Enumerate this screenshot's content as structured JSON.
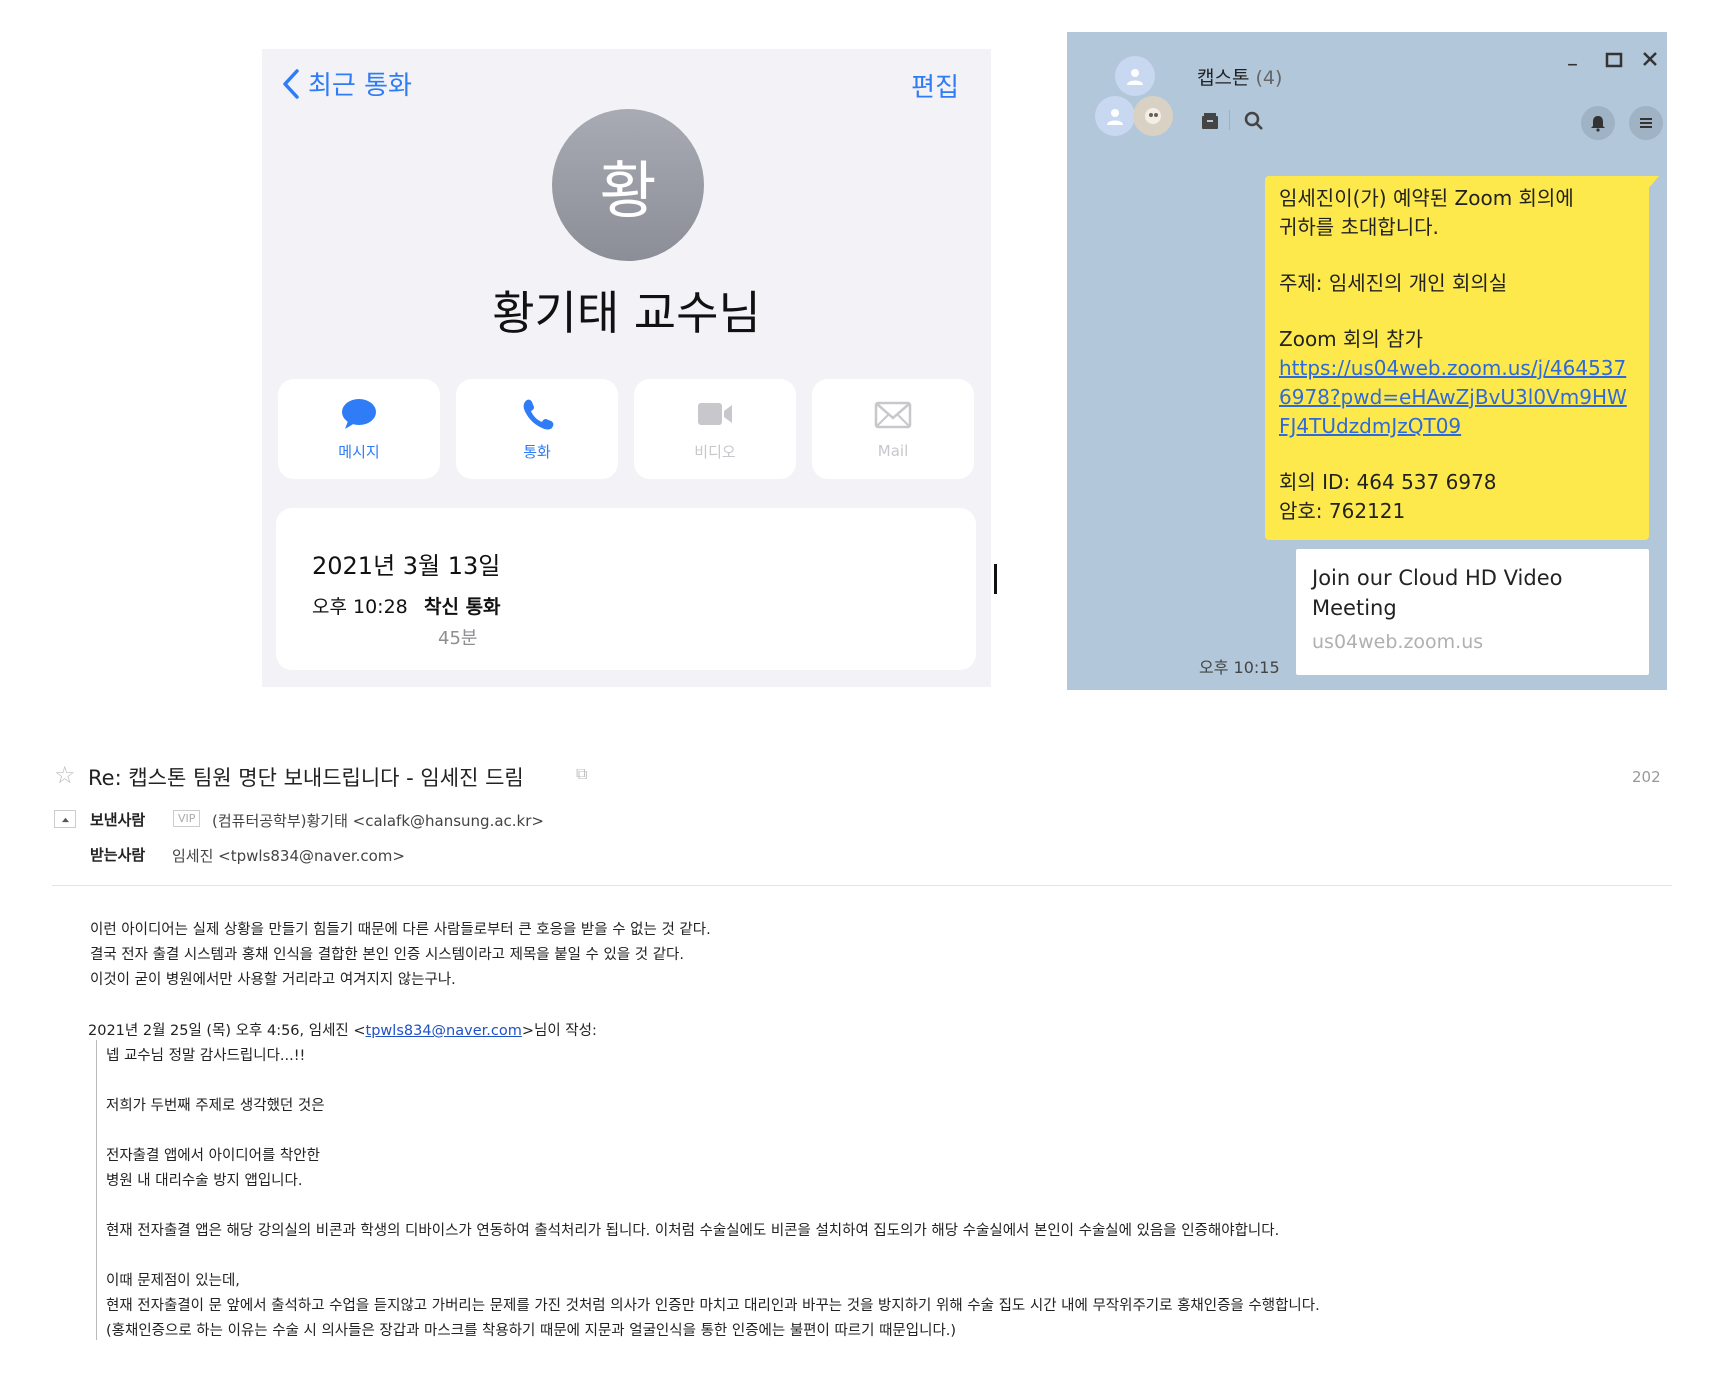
{
  "phone": {
    "back_label": "최근 통화",
    "edit_label": "편집",
    "avatar_initial": "황",
    "contact_name": "황기태 교수님",
    "actions": [
      {
        "label": "메시지",
        "icon": "message-bubble-icon",
        "enabled": true
      },
      {
        "label": "통화",
        "icon": "phone-icon",
        "enabled": true
      },
      {
        "label": "비디오",
        "icon": "video-camera-icon",
        "enabled": false
      },
      {
        "label": "Mail",
        "icon": "mail-envelope-icon",
        "enabled": false
      }
    ],
    "call": {
      "date": "2021년 3월 13일",
      "time": "오후 10:28",
      "type": "착신 통화",
      "duration": "45분"
    },
    "accent_color": "#2f7cf6"
  },
  "chat": {
    "room_name": "캡스톤",
    "member_count": "(4)",
    "message": {
      "line1": "임세진이(가) 예약된 Zoom 회의에\n귀하를 초대합니다.",
      "topic": "주제: 임세진의 개인 회의실",
      "join_label": "Zoom 회의 참가",
      "join_link": "https://us04web.zoom.us/j/4645376978?pwd=eHAwZjBvU3l0Vm9HWFJ4TUdzdmJzQT09",
      "meeting_id": "회의 ID: 464 537 6978",
      "password": "암호: 762121"
    },
    "preview": {
      "title": "Join our Cloud HD Video Meeting",
      "domain": "us04web.zoom.us"
    },
    "time": "오후 10:15",
    "bubble_color": "#fee94c",
    "background_color": "#b2c7d9"
  },
  "mail": {
    "subject": "Re: 캡스톤 팀원 명단 보내드립니다 - 임세진 드림",
    "date": "202",
    "from_label": "보낸사람",
    "vip_badge": "VIP",
    "from": "(컴퓨터공학부)황기태 <calafk@hansung.ac.kr>",
    "to_label": "받는사람",
    "to": "임세진 <tpwls834@naver.com>",
    "body": "이런 아이디어는 실제 상황을 만들기 힘들기 때문에 다른 사람들로부터 큰 호응을 받을 수 없는 것 같다.\n결국 전자 출결 시스템과 홍채 인식을 결합한 본인 인증 시스템이라고 제목을 붙일 수 있을 것 같다.\n이것이 굳이 병원에서만 사용할 거리라고 여겨지지 않는구나.",
    "quote_header_prefix": "2021년 2월 25일 (목) 오후 4:56, 임세진 <",
    "quote_header_email": "tpwls834@naver.com",
    "quote_header_suffix": ">님이 작성:",
    "quote": "넵 교수님 정말 감사드립니다...!!\n\n저희가 두번째 주제로 생각했던 것은\n\n전자출결 앱에서 아이디어를 착안한\n병원 내 대리수술 방지 앱입니다.\n\n현재 전자출결 앱은 해당 강의실의 비콘과 학생의 디바이스가 연동하여 출석처리가 됩니다. 이처럼 수술실에도 비콘을 설치하여 집도의가 해당 수술실에서 본인이 수술실에 있음을 인증해야합니다.\n\n이때 문제점이 있는데,\n현재 전자출결이 문 앞에서 출석하고 수업을 듣지않고 가버리는 문제를 가진 것처럼 의사가 인증만 마치고 대리인과 바꾸는 것을 방지하기 위해 수술 집도 시간 내에 무작위주기로 홍채인증을 수행합니다.\n(홍채인증으로 하는 이유는 수술 시 의사들은 장갑과 마스크를 착용하기 때문에 지문과 얼굴인식을 통한 인증에는 불편이 따르기 때문입니다.)"
  }
}
